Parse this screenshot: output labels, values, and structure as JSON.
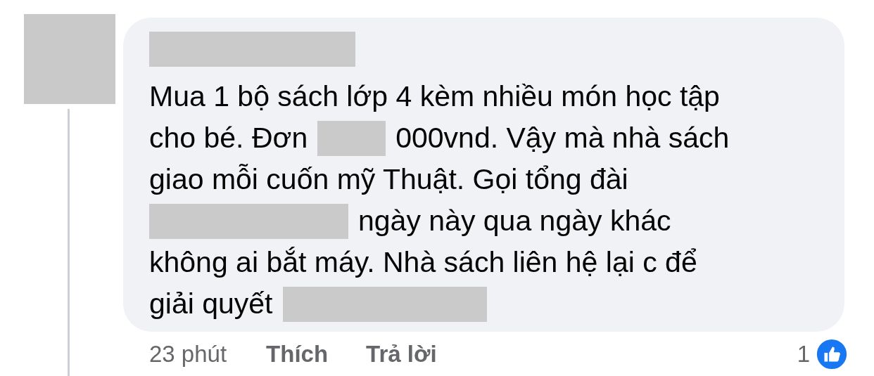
{
  "comment": {
    "author": {
      "kind": "redacted"
    },
    "lines": [
      [
        {
          "kind": "text",
          "text": "Mua 1 bộ sách lớp 4 kèm nhiều món học tập"
        }
      ],
      [
        {
          "kind": "text",
          "text": "cho bé. Đơn"
        },
        {
          "kind": "redacted"
        },
        {
          "kind": "text",
          "text": "000vnd. Vậy mà nhà sách"
        }
      ],
      [
        {
          "kind": "text",
          "text": "giao mỗi cuốn mỹ Thuật. Gọi tổng đài"
        }
      ],
      [
        {
          "kind": "redacted"
        },
        {
          "kind": "text",
          "text": "ngày này qua ngày khác"
        }
      ],
      [
        {
          "kind": "text",
          "text": "không ai bắt máy. Nhà sách liên hệ lại c để"
        }
      ],
      [
        {
          "kind": "text",
          "text": "giải quyết"
        },
        {
          "kind": "redacted"
        }
      ]
    ],
    "time": "23 phút",
    "actions": [
      "Thích",
      "Trả lời"
    ],
    "reaction_count": "1"
  }
}
